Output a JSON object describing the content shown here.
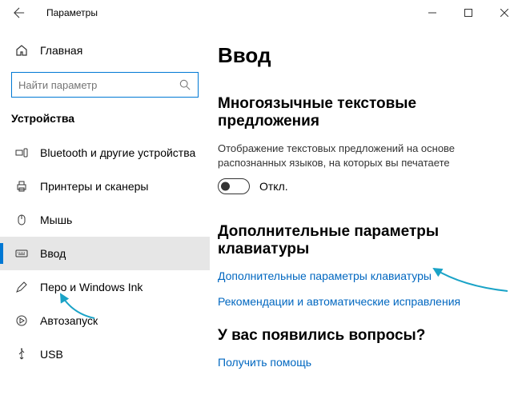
{
  "window": {
    "title": "Параметры"
  },
  "sidebar": {
    "home_label": "Главная",
    "search_placeholder": "Найти параметр",
    "group": "Устройства",
    "items": [
      {
        "label": "Bluetooth и другие устройства"
      },
      {
        "label": "Принтеры и сканеры"
      },
      {
        "label": "Мышь"
      },
      {
        "label": "Ввод"
      },
      {
        "label": "Перо и Windows Ink"
      },
      {
        "label": "Автозапуск"
      },
      {
        "label": "USB"
      }
    ]
  },
  "main": {
    "title": "Ввод",
    "section1": {
      "heading": "Многоязычные текстовые предложения",
      "desc": "Отображение текстовых предложений на основе распознанных языков, на которых вы печатаете",
      "toggle_state": "Откл."
    },
    "section2": {
      "heading": "Дополнительные параметры клавиатуры",
      "link1": "Дополнительные параметры клавиатуры",
      "link2": "Рекомендации и автоматические исправления"
    },
    "section3": {
      "heading": "У вас появились вопросы?",
      "link": "Получить помощь"
    }
  }
}
